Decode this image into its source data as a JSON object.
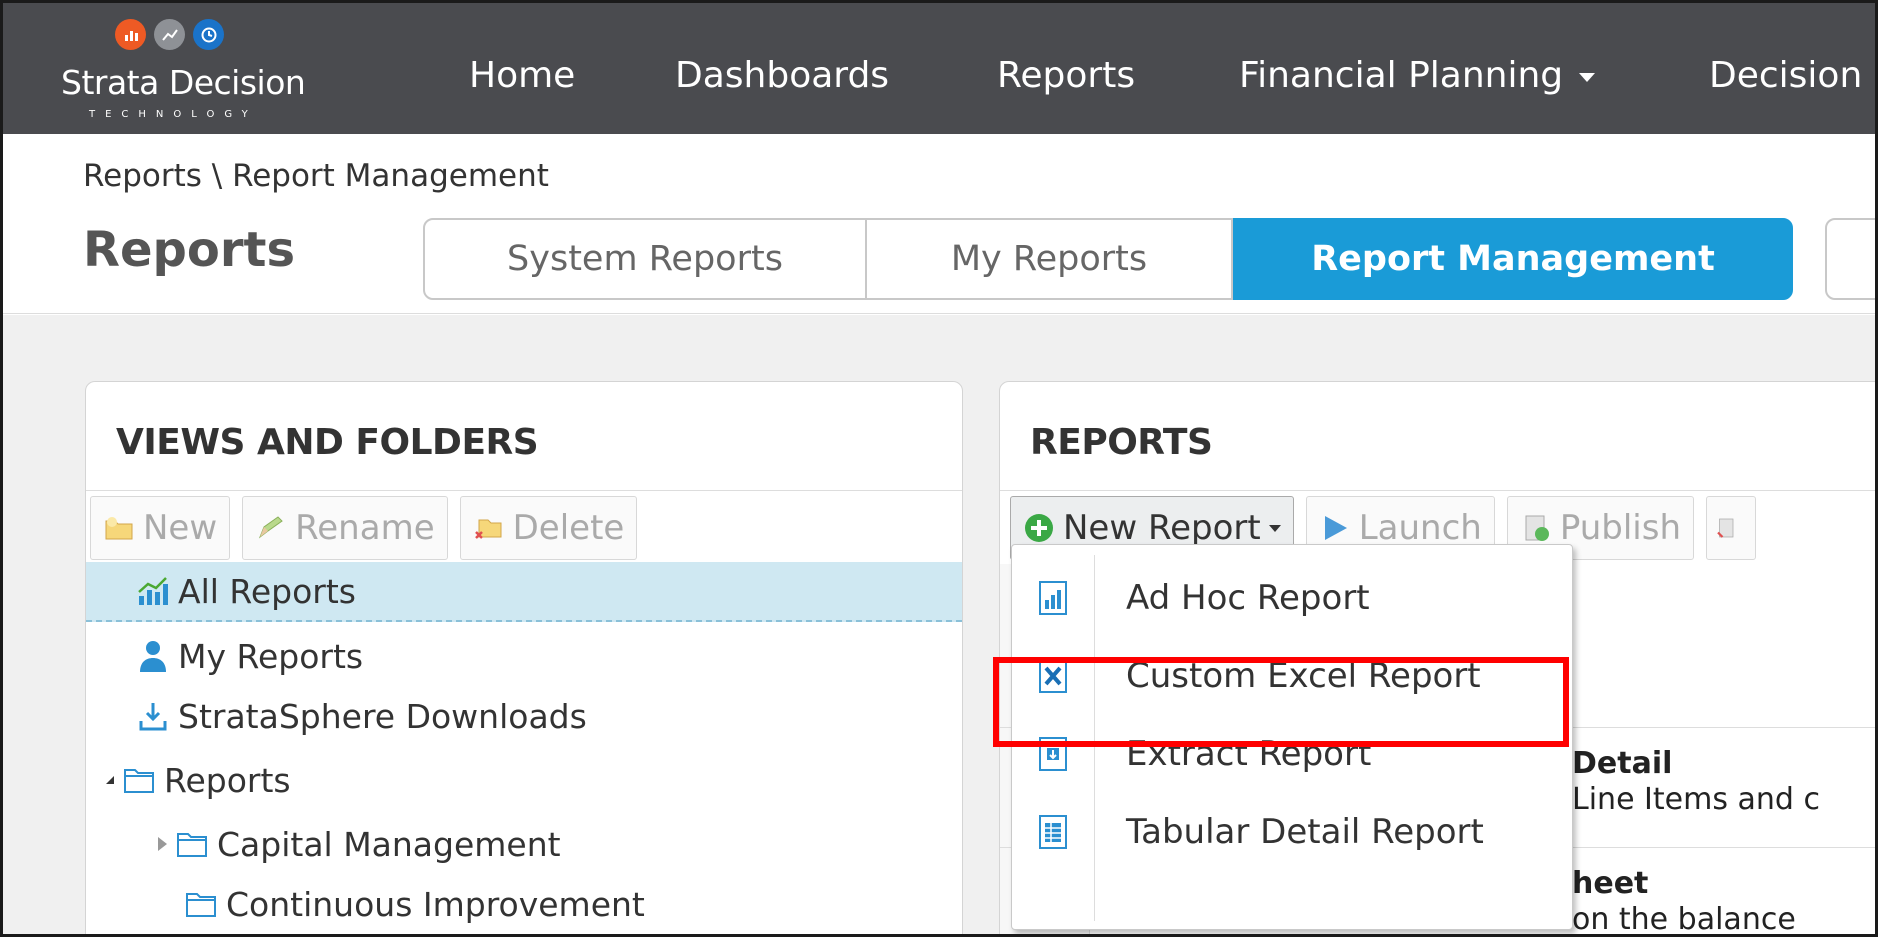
{
  "brand": {
    "name": "Strata Decision",
    "tagline": "TECHNOLOGY",
    "colors": {
      "orange": "#ee5a24",
      "gray": "#8e9196",
      "blue": "#1a73c9"
    }
  },
  "nav": {
    "home": "Home",
    "dashboards": "Dashboards",
    "reports": "Reports",
    "financial_planning": "Financial Planning",
    "decision": "Decision"
  },
  "header": {
    "breadcrumb": "Reports \\ Report Management",
    "title": "Reports",
    "tabs": [
      {
        "label": "System Reports"
      },
      {
        "label": "My Reports"
      },
      {
        "label": "Report Management"
      }
    ],
    "active_tab_color": "#1a9bd7"
  },
  "views": {
    "title": "VIEWS AND FOLDERS",
    "toolbar": {
      "new": "New",
      "rename": "Rename",
      "delete": "Delete"
    },
    "items": [
      {
        "label": "All Reports",
        "icon": "chart-icon"
      },
      {
        "label": "My Reports",
        "icon": "user-icon"
      },
      {
        "label": "StrataSphere Downloads",
        "icon": "download-icon"
      },
      {
        "label": "Reports",
        "icon": "folder-icon"
      },
      {
        "label": "Capital Management",
        "icon": "folder-icon"
      },
      {
        "label": "Continuous Improvement",
        "icon": "folder-icon"
      }
    ]
  },
  "reports": {
    "title": "REPORTS",
    "toolbar": {
      "new_report": "New Report",
      "launch": "Launch",
      "publish": "Publish"
    },
    "rows": [
      {
        "title": "Detail",
        "desc": "Line Items and c"
      },
      {
        "title": "heet",
        "desc": "on the balance"
      }
    ]
  },
  "dropdown": {
    "items": [
      {
        "label": "Ad Hoc Report",
        "icon": "chart-doc-icon"
      },
      {
        "label": "Custom Excel Report",
        "icon": "excel-icon"
      },
      {
        "label": "Extract Report",
        "icon": "extract-doc-icon"
      },
      {
        "label": "Tabular Detail Report",
        "icon": "table-doc-icon"
      }
    ],
    "highlight_color": "#ff0000"
  }
}
